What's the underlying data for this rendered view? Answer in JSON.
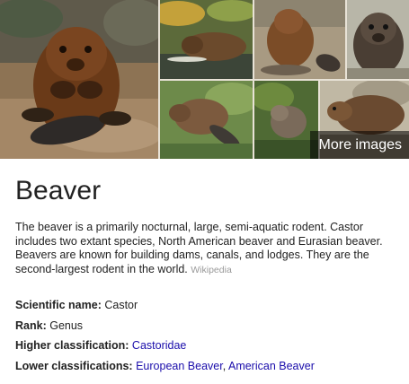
{
  "images": {
    "more_label": "More images",
    "thumbnails": [
      {
        "subject": "beaver-sitting-on-dirt"
      },
      {
        "subject": "beaver-swimming-among-leaves"
      },
      {
        "subject": "beaver-by-water"
      },
      {
        "subject": "beaver-facing-camera"
      },
      {
        "subject": "beaver-on-grass"
      },
      {
        "subject": "beaver-in-stream"
      },
      {
        "subject": "beaver-on-bank"
      }
    ]
  },
  "entity": {
    "title": "Beaver",
    "description": "The beaver is a primarily nocturnal, large, semi-aquatic rodent. Castor includes two extant species, North American beaver and Eurasian beaver. Beavers are known for building dams, canals, and lodges. They are the second-largest rodent in the world.",
    "source": "Wikipedia"
  },
  "facts": {
    "scientific_name": {
      "label": "Scientific name:",
      "value": "Castor"
    },
    "rank": {
      "label": "Rank:",
      "value": "Genus"
    },
    "higher_classification": {
      "label": "Higher classification:",
      "value": "Castoridae"
    },
    "lower_classifications": {
      "label": "Lower classifications:",
      "values": [
        "European Beaver",
        "American Beaver"
      ],
      "separator": ","
    }
  },
  "colors": {
    "text": "#222222",
    "link": "#1a0dab",
    "source": "#999999",
    "overlay": "rgba(0,0,0,0.55)"
  }
}
